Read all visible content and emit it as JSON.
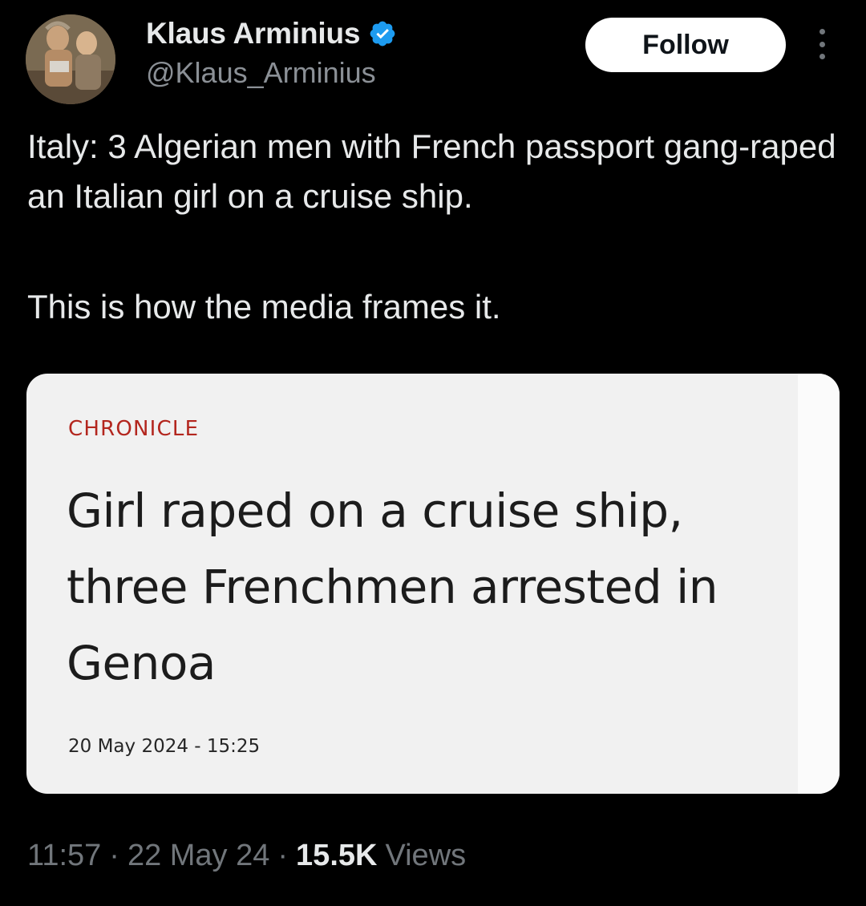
{
  "author": {
    "display_name": "Klaus Arminius",
    "handle": "@Klaus_Arminius",
    "verified_icon": "verified-badge-icon",
    "verified_color": "#1d9bf0"
  },
  "actions": {
    "follow_label": "Follow",
    "more_icon": "more-vertical-icon"
  },
  "tweet": {
    "paragraphs": [
      "Italy: 3 Algerian men with French passport gang-raped an Italian girl on a cruise ship.",
      "This is how the media frames it."
    ]
  },
  "embedded_article": {
    "section": "CHRONICLE",
    "headline": "Girl raped on a cruise ship, three Frenchmen arrested in Genoa",
    "date": "20 May 2024 - 15:25",
    "section_color": "#b3261e"
  },
  "meta": {
    "time": "11:57",
    "separator": "·",
    "date": "22 May 24",
    "views_count": "15.5K",
    "views_label": "Views"
  }
}
